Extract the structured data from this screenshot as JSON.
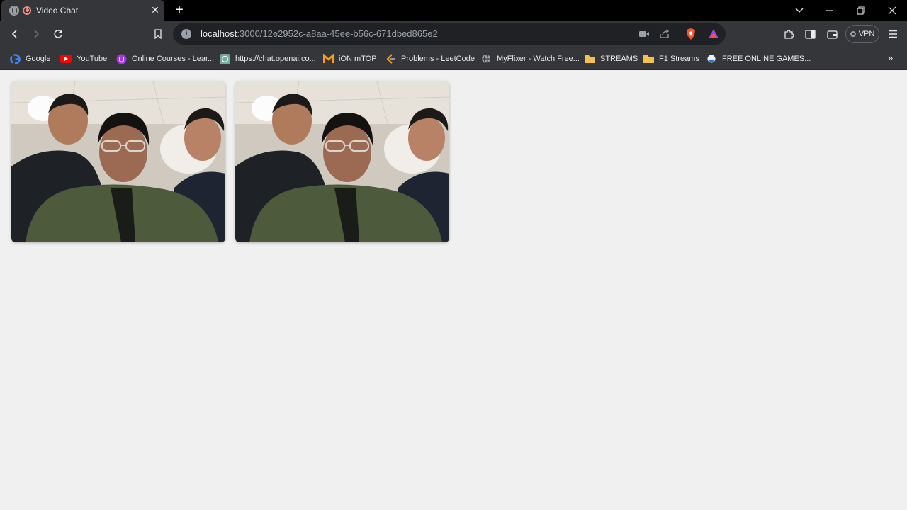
{
  "tab": {
    "title": "Video Chat",
    "close_label": "✕"
  },
  "newtab_label": "+",
  "address": {
    "host": "localhost",
    "rest": ":3000/12e2952c-a8aa-45ee-b56c-671dbed865e2"
  },
  "vpn_label": "VPN",
  "bookmarks": [
    {
      "label": "Google",
      "icon": "google-icon"
    },
    {
      "label": "YouTube",
      "icon": "youtube-icon"
    },
    {
      "label": "Online Courses - Lear...",
      "icon": "udemy-icon"
    },
    {
      "label": "https://chat.openai.co...",
      "icon": "openai-icon"
    },
    {
      "label": "iON mTOP",
      "icon": "mtop-icon"
    },
    {
      "label": "Problems - LeetCode",
      "icon": "leetcode-icon"
    },
    {
      "label": "MyFlixer - Watch Free...",
      "icon": "globe-icon"
    },
    {
      "label": "STREAMS",
      "icon": "folder-icon"
    },
    {
      "label": "F1 Streams",
      "icon": "folder-icon"
    },
    {
      "label": "FREE ONLINE GAMES...",
      "icon": "games-icon"
    }
  ],
  "bookmarks_overflow": "»",
  "videos": [
    {
      "name": "local-video"
    },
    {
      "name": "remote-video"
    }
  ],
  "colors": {
    "tab_bg": "#35363a",
    "frame_bg": "#000000",
    "page_bg": "#f0f0f0"
  }
}
